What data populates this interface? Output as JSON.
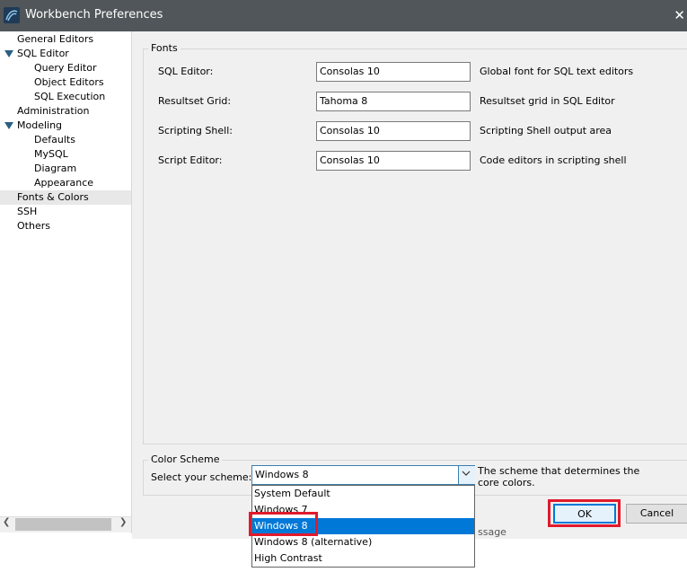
{
  "window": {
    "title": "Workbench Preferences",
    "close_glyph": "✕"
  },
  "tree": {
    "items": [
      {
        "label": "General Editors"
      },
      {
        "label": "SQL Editor"
      },
      {
        "label": "Query Editor"
      },
      {
        "label": "Object Editors"
      },
      {
        "label": "SQL Execution"
      },
      {
        "label": "Administration"
      },
      {
        "label": "Modeling"
      },
      {
        "label": "Defaults"
      },
      {
        "label": "MySQL"
      },
      {
        "label": "Diagram"
      },
      {
        "label": "Appearance"
      },
      {
        "label": "Fonts & Colors"
      },
      {
        "label": "SSH"
      },
      {
        "label": "Others"
      }
    ],
    "selected": "Fonts & Colors"
  },
  "fonts": {
    "legend": "Fonts",
    "rows": [
      {
        "label": "SQL Editor:",
        "value": "Consolas 10",
        "desc": "Global font for SQL text editors"
      },
      {
        "label": "Resultset Grid:",
        "value": "Tahoma 8",
        "desc": "Resultset grid in SQL Editor"
      },
      {
        "label": "Scripting Shell:",
        "value": "Consolas 10",
        "desc": "Scripting Shell output area"
      },
      {
        "label": "Script Editor:",
        "value": "Consolas 10",
        "desc": "Code editors in scripting shell"
      }
    ]
  },
  "scheme": {
    "legend": "Color Scheme",
    "label": "Select your scheme:",
    "value": "Windows 8",
    "desc": "The scheme that determines the core colors.",
    "options": [
      "System Default",
      "Windows 7",
      "Windows 8",
      "Windows 8 (alternative)",
      "High Contrast"
    ],
    "selected": "Windows 8"
  },
  "buttons": {
    "ok": "OK",
    "cancel": "Cancel"
  },
  "colors": {
    "highlight": "#0078d7",
    "annotation_red": "#e11a2b",
    "titlebar": "#505659"
  },
  "icons": [
    "app-icon",
    "close-icon",
    "expand-arrow-icon",
    "chevron-down-icon",
    "scroll-left-icon",
    "scroll-right-icon"
  ]
}
